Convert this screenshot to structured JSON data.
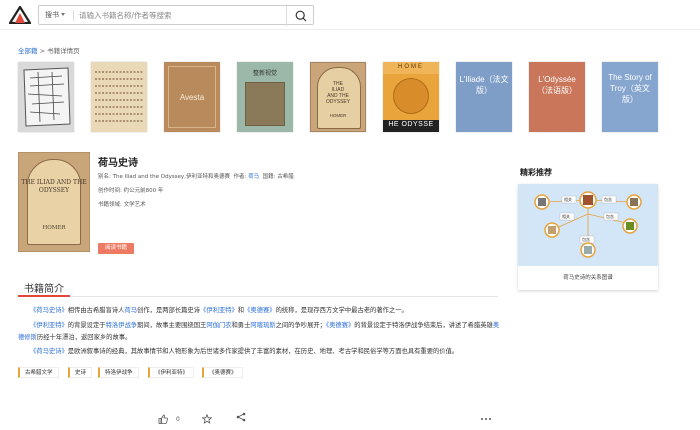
{
  "search": {
    "scope_label": "搜书",
    "placeholder": "请输入书籍名称/作者等搜索"
  },
  "breadcrumb": {
    "home": "全部籍",
    "sep": " > ",
    "current": "书籍详情页"
  },
  "covers": [
    {
      "label": ""
    },
    {
      "label": ""
    },
    {
      "label": "Avesta"
    },
    {
      "label": "整新视觉"
    },
    {
      "label": "THE ILIAD AND THE ODYSSEY HOMER"
    },
    {
      "label": "HOME / HE ODYSSE"
    },
    {
      "label": "L'Iliade（法文版）"
    },
    {
      "label": "L'Odyssée（法语版）"
    },
    {
      "label": "The Story of Troy（英文版）"
    }
  ],
  "book": {
    "title": "荷马史诗",
    "alias_label": "别名:",
    "alias": "The Iliad and the Odyssey,伊利亚特和奥德赛",
    "author_label": "作者:",
    "author": "荷马",
    "nation_label": "国籍:",
    "nation": "古希腊",
    "era_label": "创作时间:",
    "era": "约公元前800 年",
    "field_label": "书籍领域:",
    "field": "文学艺术",
    "read_button": "阅读书籍",
    "cover_title": "THE ILIAD AND THE ODYSSEY",
    "cover_author": "HOMER"
  },
  "intro": {
    "heading": "书籍简介",
    "p1": {
      "a": "《荷马史诗》",
      "b": "相传由古希腊盲诗人",
      "c": "荷马",
      "d": "创作，是两部长篇史诗",
      "e": "《伊利亚特》",
      "f": "和",
      "g": "《奥德赛》",
      "h": "的统称，是现存西方文学中最古老的著作之一。"
    },
    "p2": {
      "a": "《伊利亚特》",
      "b": "的背景设定于",
      "c": "特洛伊战争",
      "d": "期间，故事主要围绕国王",
      "e": "阿伽门农",
      "f": "和勇士",
      "g": "阿喀琉斯",
      "h": "之间的争吵展开；",
      "i": "《奥德赛》",
      "j": "的背景设定于特洛伊战争结束后，讲述了希腊英雄",
      "k": "奥德修斯",
      "l": "历经十年漂泊，返回家乡的故事。"
    },
    "p3": {
      "a": "《荷马史诗》",
      "b": "是欧洲叙事诗的经典，其故事情节和人物形象为后世诸多作家提供了丰富的素材，在历史、地理、考古学和民俗学等方面也具有重要的价值。"
    }
  },
  "tags": [
    "古希腊文学",
    "史诗",
    "特洛伊战争",
    "《伊利亚特》",
    "《奥德赛》"
  ],
  "footer": {
    "like_count": "0"
  },
  "sidebar": {
    "title": "精彩推荐",
    "caption": "荷马史诗的关系图谱",
    "graph": {
      "n1": "相关",
      "n2": "包含",
      "n3": "包含",
      "n4": "相关",
      "n5": "包含"
    }
  },
  "colors": {
    "accent": "#e2473b",
    "link": "#2a6fd6",
    "button": "#ef7a63"
  }
}
